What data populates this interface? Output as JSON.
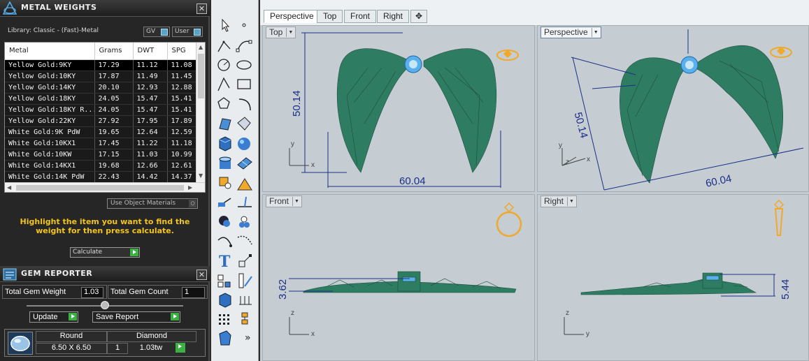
{
  "colors": {
    "accent_gold": "#f3c51c",
    "model_green": "#2e7d62",
    "gem_blue": "#5ab0ec",
    "dimension_blue": "#1b2f88",
    "ring_icon_orange": "#f0a928"
  },
  "metal_weights": {
    "title": "METAL WEIGHTS",
    "library_label": "Library: Classic - (Fast)-Metal",
    "toggle_gv": "GV",
    "toggle_user": "User",
    "columns": [
      "Metal",
      "Grams",
      "DWT",
      "SPG"
    ],
    "rows": [
      {
        "metal": "Yellow Gold:9KY",
        "grams": "17.29",
        "dwt": "11.12",
        "spg": "11.08"
      },
      {
        "metal": "Yellow Gold:10KY",
        "grams": "17.87",
        "dwt": "11.49",
        "spg": "11.45"
      },
      {
        "metal": "Yellow Gold:14KY",
        "grams": "20.10",
        "dwt": "12.93",
        "spg": "12.88"
      },
      {
        "metal": "Yellow Gold:18KY",
        "grams": "24.05",
        "dwt": "15.47",
        "spg": "15.41"
      },
      {
        "metal": "Yellow Gold:18KY R...",
        "grams": "24.05",
        "dwt": "15.47",
        "spg": "15.41"
      },
      {
        "metal": "Yellow Gold:22KY",
        "grams": "27.92",
        "dwt": "17.95",
        "spg": "17.89"
      },
      {
        "metal": "White Gold:9K PdW",
        "grams": "19.65",
        "dwt": "12.64",
        "spg": "12.59"
      },
      {
        "metal": "White Gold:10KX1",
        "grams": "17.45",
        "dwt": "11.22",
        "spg": "11.18"
      },
      {
        "metal": "White Gold:10KW",
        "grams": "17.15",
        "dwt": "11.03",
        "spg": "10.99"
      },
      {
        "metal": "White Gold:14KX1",
        "grams": "19.68",
        "dwt": "12.66",
        "spg": "12.61"
      },
      {
        "metal": "White Gold:14K PdW",
        "grams": "22.43",
        "dwt": "14.42",
        "spg": "14.37"
      }
    ],
    "use_object_materials": "Use Object Materials",
    "hint": "Highlight the item you want to find the weight for then press calculate.",
    "calculate_label": "Calculate"
  },
  "gem_reporter": {
    "title": "GEM REPORTER",
    "total_weight_label": "Total Gem Weight",
    "total_weight_value": "1.03",
    "total_count_label": "Total Gem Count",
    "total_count_value": "1",
    "update_label": "Update",
    "save_report_label": "Save Report",
    "gem": {
      "shape": "Round",
      "size": "6.50 X 6.50",
      "type": "Diamond",
      "count": "1",
      "weight": "1.03tw"
    }
  },
  "tabs": [
    "Perspective",
    "Top",
    "Front",
    "Right"
  ],
  "viewports": {
    "top": {
      "label": "Top",
      "dim_height": "50.14",
      "dim_width": "60.04",
      "axis_y": "y",
      "axis_x": "x"
    },
    "perspective": {
      "label": "Perspective",
      "dim_height": "50.14",
      "dim_width": "60.04",
      "axis_y": "y",
      "axis_z": "z",
      "axis_x": "x"
    },
    "front": {
      "label": "Front",
      "dim_height": "3.62",
      "axis_z": "z",
      "axis_x": "x"
    },
    "right": {
      "label": "Right",
      "dim_height": "5.44",
      "axis_z": "z",
      "axis_y": "y"
    }
  },
  "toolbar": {
    "more_label": "»"
  }
}
